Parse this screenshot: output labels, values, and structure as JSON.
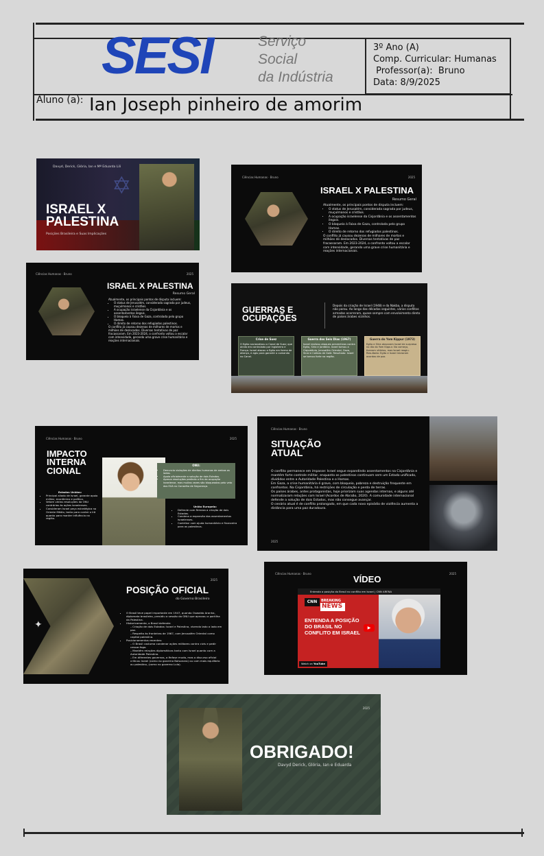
{
  "header": {
    "logo_text": "SESI",
    "logo_sub": [
      "Serviço",
      "Social",
      "da Indústria"
    ],
    "info": {
      "year": "3º Ano (A)",
      "component": "Comp. Curricular:  Humanas",
      "teacher": " Professor(a):  Bruno",
      "date": "Data: 8/9/2025"
    },
    "student_label": "Aluno (a):",
    "student_name": "Ian Joseph pinheiro de amorim"
  },
  "slides": {
    "s1": {
      "authors": "Davyd, Derick, Glória, Ian e Mª Eduarda Lili",
      "title": "ISRAEL X PALESTINA",
      "subtitle": "Posições Brasileira e Suas Implicações"
    },
    "s2": {
      "tag": "Ciências Humanas · Bruno",
      "year": "2025",
      "title": "ISRAEL X PALESTINA",
      "subtitle": "Resumo Geral",
      "intro": "Atualmente, os principais pontos de disputa incluem:",
      "bullets": [
        "O status de Jerusalém, considerada sagrada por judeus, muçulmanos e cristãos.",
        "A ocupação israelense da Cisjordânia e os assentamentos ilegais.",
        "O bloqueio à Faixa de Gaza, controlada pelo grupo Hamas.",
        "O direito de retorno dos refugiados palestinos."
      ],
      "closing": "O conflito já causou dezenas de milhares de mortos e milhões de deslocados. Diversas tentativas de paz fracassaram. Em 2023-2024, o confronto voltou a escalar com intensidade, gerando uma grave crise humanitária e reações internacionais."
    },
    "s3": {
      "tag": "Ciências Humanas · Bruno",
      "year": "2025",
      "title": "ISRAEL X PALESTINA",
      "subtitle": "Resumo Geral",
      "intro": "Atualmente, os principais pontos de disputa incluem:",
      "bullets": [
        "O status de Jerusalém, considerada sagrada por judeus, muçulmanos e cristãos.",
        "A ocupação israelense da Cisjordânia e os assentamentos ilegais.",
        "O bloqueio à Faixa de Gaza, controlada pelo grupo Hamas.",
        "O direito de retorno dos refugiados palestinos."
      ],
      "closing": "O conflito já causou dezenas de milhares de mortos e milhões de deslocados. Diversas tentativas de paz fracassaram. Em 2023-2024, o confronto voltou a escalar com intensidade, gerando uma grave crise humanitária e reações internacionais."
    },
    "s4": {
      "title": "GUERRAS E OCUPAÇÕES",
      "intro": "Depois da criação de Israel (1948) e da Nakba, a disputa não parou. Ao longo das décadas seguintes, vários conflitos armados ocorreram, quase sempre com envolvimento direto de países árabes vizinhos.",
      "cards": [
        {
          "title": "Crise de Suez",
          "text": "O Egito nacionalizou o Canal de Suez; que ainda era controlado por Inglaterra e França. Israel atacou o Egito em forma de aliança, e agiu para garantir o comando no Canal."
        },
        {
          "title": "Guerra dos Seis Dias (1967)",
          "text": "Israel realizou ataques preventivos contra Egito, Síria e Jordânia. Israel tomou a Cisjordânia, Jerusalém Oriental, Gaza, Sinai e Colinas de Golã. Resultado: Israel se tornou forte na região."
        },
        {
          "title": "Guerra do Yom Kippur (1973)",
          "text": "Egito e Síria atacaram Israel de surpresa no dia do Yom Kippur. No começo, tiveram vitórias, mas Israel reagiu. Resultado: Egito e Israel iniciaram acordos de paz."
        }
      ]
    },
    "s5": {
      "tag": "Ciências Humanas · Bruno",
      "year": "2025",
      "title": "IMPACTO INTERNACIONAL",
      "title_lines": [
        "IMPACTO",
        "INTERNA",
        "CIONAL"
      ],
      "left_heading": "Estados Unidos:",
      "left_bullets": [
        "Principal aliado de Israel, garante apoio militar, econômico e político.",
        "Vetam várias resoluções da ONU contrárias às ações israelenses.",
        "Consideram Israel peça estratégica no Oriente Médio, tanto para conter o Irã quanto para manter influência na região."
      ],
      "onu_heading": "ONU:",
      "onu_bullets": [
        "Denuncia violações de direitos humanos de ambos os lados.",
        "Apoia oficialmente a solução de dois Estados.",
        "Aprova resoluções pedindo o fim da ocupação israelense, mas muitas vezes são bloqueadas pelo veto dos EUA no Conselho de Segurança."
      ],
      "eu_heading": "União Europeia:",
      "eu_bullets": [
        "Defende com firmeza a criação de dois Estados.",
        "Condena a expansão dos assentamentos israelenses.",
        "Contribui com ajuda humanitária e financeira para os palestinos."
      ]
    },
    "s6": {
      "tag": "Ciências Humanas · Bruno",
      "title_lines": [
        "SITUAÇÃO",
        "ATUAL"
      ],
      "year": "2025",
      "body": [
        "O conflito permanece em impasse: Israel segue expandindo assentamentos na Cisjordânia e mantém forte controle militar, enquanto os palestinos continuam sem um Estado unificado, divididos entre a Autoridade Palestina e o Hamas.",
        "Em Gaza, a crise humanitária é grave, com bloqueio, pobreza e destruição frequente em confrontos. Na Cisjordânia, há restrições de circulação e perda de terras.",
        "Os países árabes, antes protagonistas, hoje priorizam suas agendas internas, e alguns até normalizaram relações com Israel (Acordos de Abraão, 2020). A comunidade internacional defende a solução de dois Estados, mas não consegue avançar.",
        "O cenário atual é de conflito prolongado, em que cada novo episódio de violência aumenta a distância para uma paz duradoura."
      ]
    },
    "s7": {
      "year": "2025",
      "title": "POSIÇÃO OFICIAL",
      "subtitle": "do Governo Brasileiro",
      "bullets": [
        "O Brasil teve papel importante em 1947, quando Oswaldo Aranha, diplomata brasileiro, presidiu a sessão da ONU que aprovou a partilha da Palestina.",
        "Historicamente, o Brasil defende:",
        "– Criação de dois Estados: Israel e Palestina, vivendo lado a lado em paz.",
        "– Respeito às fronteiras de 1967, com Jerusalém Oriental como capital palestina.",
        "Posicionamentos recentes:",
        "– O Brasil costuma condenar ações militares contra civis e pedir cessar-fogo.",
        "– Mantém relações diplomáticas tanto com Israel quanto com a Autoridade Palestina.",
        "– Em diferentes governos, a ênfase muda, mas o discurso oficial criticou Israel (como no governo Bolsonaro) ou com mais equilíbrio ou palestino, (como no governo Lula)."
      ]
    },
    "s8": {
      "tag": "Ciências Humanas · Bruno",
      "year": "2025",
      "title": "VÍDEO",
      "video_caption": "Entenda a posição do Brasil no conflito em Israel | CNN ARENA",
      "breaking": "BREAKING",
      "news": "NEWS",
      "cnn": "CNN",
      "headline_lines": [
        "ENTENDA A POSIÇÃO",
        "DO BRASIL NO",
        "CONFLITO EM ISRAEL"
      ],
      "watch": "Watch on",
      "youtube": "YouTube"
    },
    "s9": {
      "year": "2025",
      "title": "OBRIGADO!",
      "authors": "Davyd  Derick, Glória, Ian e Eduarda"
    }
  }
}
